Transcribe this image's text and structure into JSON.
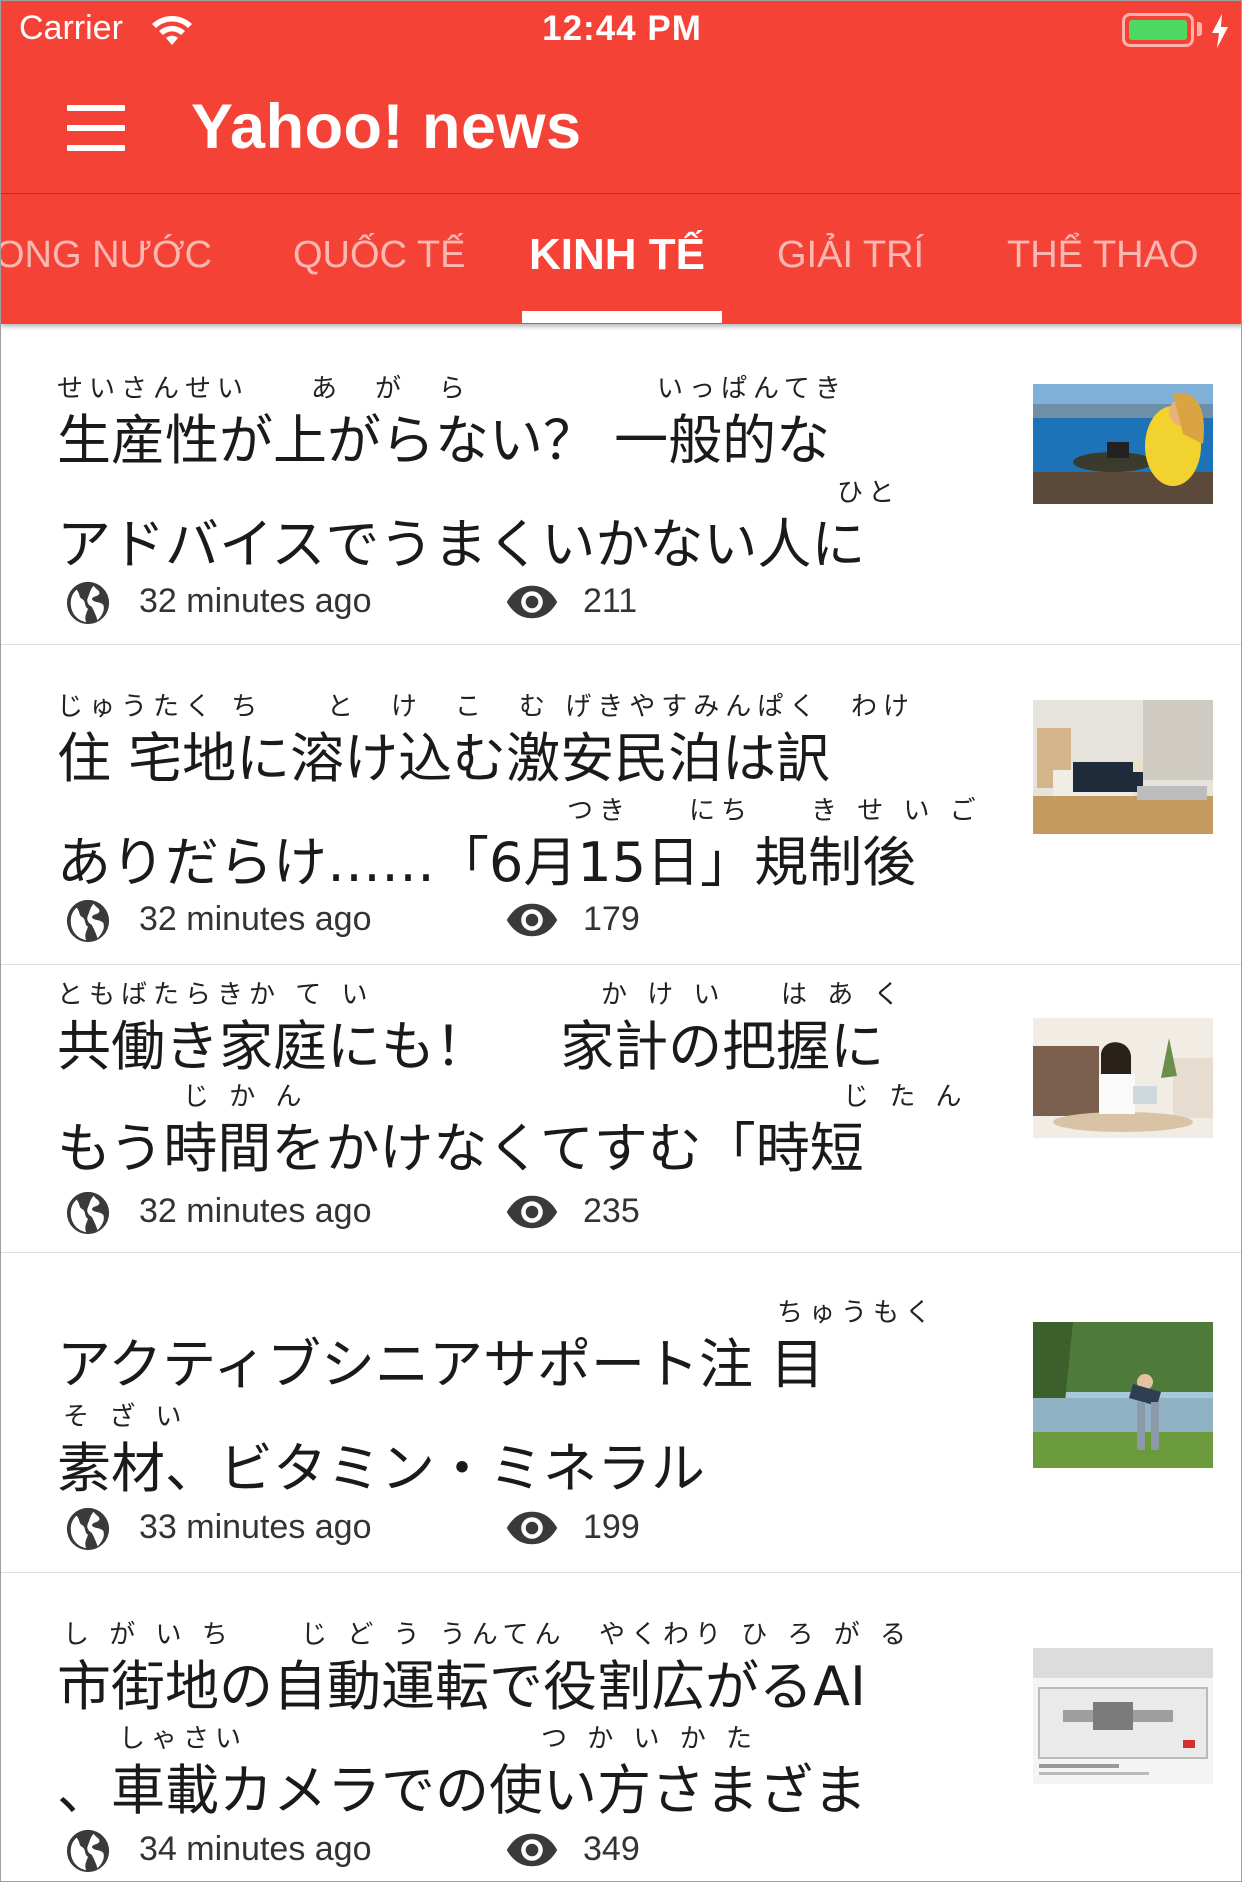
{
  "status_bar": {
    "carrier": "Carrier",
    "time": "12:44 PM"
  },
  "app_bar": {
    "title": "Yahoo! news"
  },
  "tabs": [
    {
      "label": "ONG NƯỚC"
    },
    {
      "label": "QUỐC TẾ"
    },
    {
      "label": "KINH TẾ",
      "active": true
    },
    {
      "label": "GIẢI TRÍ"
    },
    {
      "label": "THỂ THAO"
    }
  ],
  "articles": [
    {
      "line1": "生産性が上がらない？ 一般的な",
      "line2": "アドバイスでうまくいかない人に",
      "ruby": [
        "せいさんせい",
        "あ　が　ら",
        "いっぱんてき",
        "ひと"
      ],
      "time": "32 minutes ago",
      "views": "211"
    },
    {
      "line1": "住 宅地に溶け込む激安民泊は訳",
      "line2": "ありだらけ……「6月15日」規制後",
      "ruby": [
        "じゅうたく ち",
        "と　け　こ　む げきやすみんぱく",
        "わけ",
        "つき",
        "にち",
        "き せ い ご"
      ],
      "time": "32 minutes ago",
      "views": "179"
    },
    {
      "line1": "共働き家庭にも！　 家計の把握に",
      "line2": "もう時間をかけなくてすむ「時短",
      "ruby": [
        "ともばたらきか て い",
        "か け い",
        "は あ く",
        "じ か ん",
        "じ た ん"
      ],
      "time": "32 minutes ago",
      "views": "235"
    },
    {
      "line1": "アクティブシニアサポート注 目",
      "line2": "素材、ビタミン・ミネラル",
      "ruby": [
        "ちゅうもく",
        "そ ざ い"
      ],
      "time": "33 minutes ago",
      "views": "199"
    },
    {
      "line1": "市街地の自動運転で役割広がるAI",
      "line2": "、車載カメラでの使い方さまざま",
      "ruby": [
        "し が い ち",
        "じ ど う うんてん",
        "やくわり ひ ろ が る",
        "しゃさい",
        "つ か い か た"
      ],
      "time": "34 minutes ago",
      "views": "349"
    }
  ],
  "icons": {
    "globe": "globe-icon",
    "views": "eye-icon",
    "menu": "menu-icon"
  },
  "colors": {
    "primary": "#f44336",
    "battery": "#4cd964"
  }
}
